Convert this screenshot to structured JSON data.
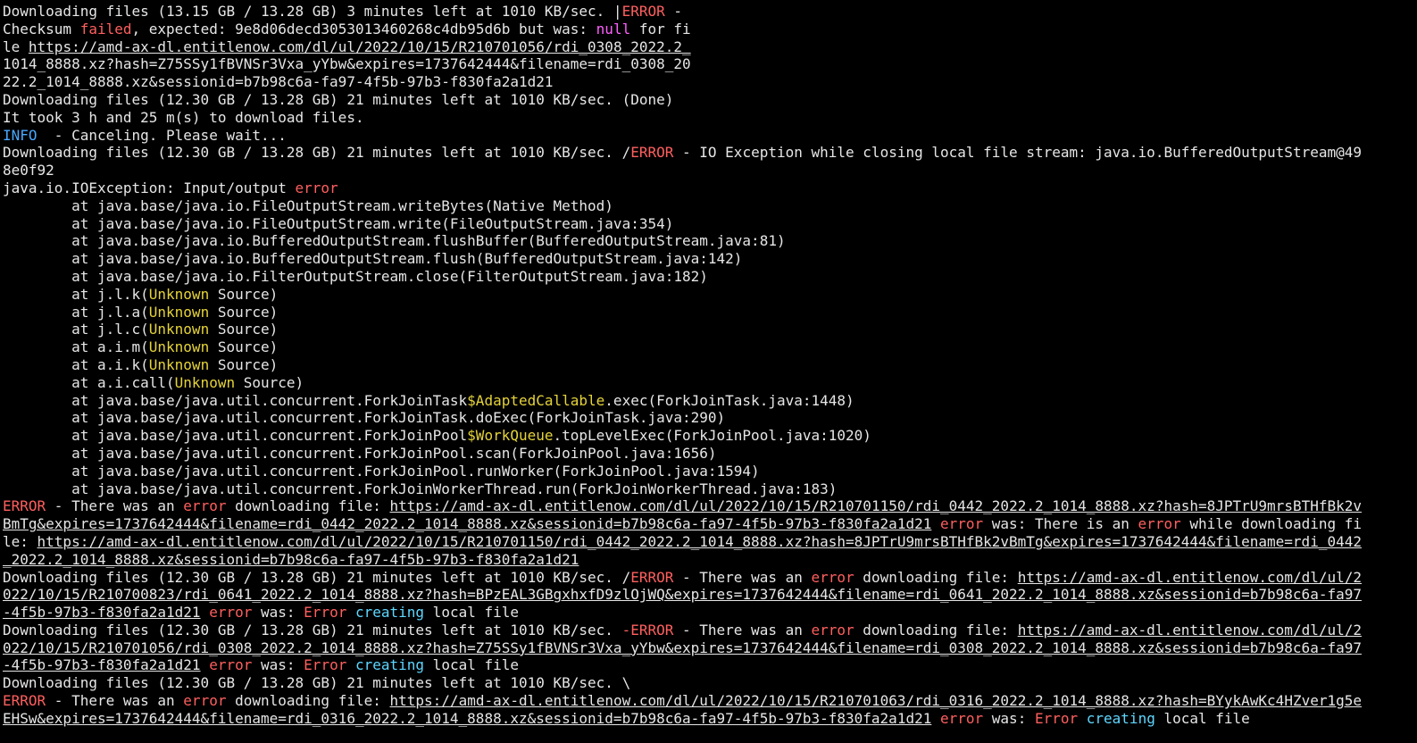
{
  "terminal": {
    "lines": [
      [
        [
          "Downloading files (13.15 GB / 13.28 GB) 3 minutes left at 1010 KB/sec. |",
          ""
        ],
        [
          "ERROR",
          "err"
        ],
        [
          " -",
          ""
        ]
      ],
      [
        [
          "Checksum ",
          ""
        ],
        [
          "failed",
          "err"
        ],
        [
          ", expected: 9e8d06decd3053013460268c4db95d6b but was: ",
          ""
        ],
        [
          "null",
          "magenta"
        ],
        [
          " for fi",
          ""
        ]
      ],
      [
        [
          "le ",
          ""
        ],
        [
          "https://amd-ax-dl.entitlenow.com/dl/ul/2022/10/15/R210701056/rdi_0308_2022.2_",
          "url"
        ]
      ],
      [
        [
          "1014_8888.xz?hash=Z75SSy1fBVNSr3Vxa_yYbw&expires=1737642444&filename=rdi_0308_20",
          ""
        ]
      ],
      [
        [
          "22.2_1014_8888.xz&sessionid=b7b98c6a-fa97-4f5b-97b3-f830fa2a1d21",
          ""
        ]
      ],
      [
        [
          "Downloading files (12.30 GB / 13.28 GB) 21 minutes left at 1010 KB/sec. (Done)",
          ""
        ]
      ],
      [
        [
          "It took 3 h and 25 m(s) to download files.",
          ""
        ]
      ],
      [
        [
          "INFO",
          "info"
        ],
        [
          "  - Canceling. Please wait...",
          ""
        ]
      ],
      [
        [
          "Downloading files (12.30 GB / 13.28 GB) 21 minutes left at 1010 KB/sec. /",
          ""
        ],
        [
          "ERROR",
          "err"
        ],
        [
          " - IO Exception while closing local file stream: java.io.BufferedOutputStream@49",
          ""
        ]
      ],
      [
        [
          "8e0f92",
          ""
        ]
      ],
      [
        [
          "java.io.IOException: Input/output ",
          ""
        ],
        [
          "error",
          "err"
        ]
      ],
      [
        [
          "        at java.base/java.io.FileOutputStream.writeBytes(Native Method)",
          ""
        ]
      ],
      [
        [
          "        at java.base/java.io.FileOutputStream.write(FileOutputStream.java:354)",
          ""
        ]
      ],
      [
        [
          "        at java.base/java.io.BufferedOutputStream.flushBuffer(BufferedOutputStream.java:81)",
          ""
        ]
      ],
      [
        [
          "        at java.base/java.io.BufferedOutputStream.flush(BufferedOutputStream.java:142)",
          ""
        ]
      ],
      [
        [
          "        at java.base/java.io.FilterOutputStream.close(FilterOutputStream.java:182)",
          ""
        ]
      ],
      [
        [
          "        at j.l.k(",
          ""
        ],
        [
          "Unknown",
          "yellow"
        ],
        [
          " Source)",
          ""
        ]
      ],
      [
        [
          "        at j.l.a(",
          ""
        ],
        [
          "Unknown",
          "yellow"
        ],
        [
          " Source)",
          ""
        ]
      ],
      [
        [
          "        at j.l.c(",
          ""
        ],
        [
          "Unknown",
          "yellow"
        ],
        [
          " Source)",
          ""
        ]
      ],
      [
        [
          "        at a.i.m(",
          ""
        ],
        [
          "Unknown",
          "yellow"
        ],
        [
          " Source)",
          ""
        ]
      ],
      [
        [
          "        at a.i.k(",
          ""
        ],
        [
          "Unknown",
          "yellow"
        ],
        [
          " Source)",
          ""
        ]
      ],
      [
        [
          "        at a.i.call(",
          ""
        ],
        [
          "Unknown",
          "yellow"
        ],
        [
          " Source)",
          ""
        ]
      ],
      [
        [
          "        at java.base/java.util.concurrent.ForkJoinTask",
          ""
        ],
        [
          "$AdaptedCallable",
          "yellow"
        ],
        [
          ".exec(ForkJoinTask.java:1448)",
          ""
        ]
      ],
      [
        [
          "        at java.base/java.util.concurrent.ForkJoinTask.doExec(ForkJoinTask.java:290)",
          ""
        ]
      ],
      [
        [
          "        at java.base/java.util.concurrent.ForkJoinPool",
          ""
        ],
        [
          "$WorkQueue",
          "yellow"
        ],
        [
          ".topLevelExec(ForkJoinPool.java:1020)",
          ""
        ]
      ],
      [
        [
          "        at java.base/java.util.concurrent.ForkJoinPool.scan(ForkJoinPool.java:1656)",
          ""
        ]
      ],
      [
        [
          "        at java.base/java.util.concurrent.ForkJoinPool.runWorker(ForkJoinPool.java:1594)",
          ""
        ]
      ],
      [
        [
          "        at java.base/java.util.concurrent.ForkJoinWorkerThread.run(ForkJoinWorkerThread.java:183)",
          ""
        ]
      ],
      [
        [
          "ERROR",
          "err"
        ],
        [
          " - There was an ",
          ""
        ],
        [
          "error",
          "err"
        ],
        [
          " downloading file: ",
          ""
        ],
        [
          "https://amd-ax-dl.entitlenow.com/dl/ul/2022/10/15/R210701150/rdi_0442_2022.2_1014_8888.xz?hash=8JPTrU9mrsBTHfBk2v",
          "url"
        ]
      ],
      [
        [
          "BmTg&expires=1737642444&filename=rdi_0442_2022.2_1014_8888.xz&sessionid=b7b98c6a-fa97-4f5b-97b3-f830fa2a1d21",
          "url"
        ],
        [
          " ",
          ""
        ],
        [
          "error",
          "err"
        ],
        [
          " was: There is an ",
          ""
        ],
        [
          "error",
          "err"
        ],
        [
          " while downloading fi",
          ""
        ]
      ],
      [
        [
          "le: ",
          ""
        ],
        [
          "https://amd-ax-dl.entitlenow.com/dl/ul/2022/10/15/R210701150/rdi_0442_2022.2_1014_8888.xz?hash=8JPTrU9mrsBTHfBk2vBmTg&expires=1737642444&filename=rdi_0442",
          "url"
        ]
      ],
      [
        [
          "_2022.2_1014_8888.xz&sessionid=b7b98c6a-fa97-4f5b-97b3-f830fa2a1d21",
          "url"
        ]
      ],
      [
        [
          "Downloading files (12.30 GB / 13.28 GB) 21 minutes left at 1010 KB/sec. /",
          ""
        ],
        [
          "ERROR",
          "err"
        ],
        [
          " - There was an ",
          ""
        ],
        [
          "error",
          "err"
        ],
        [
          " downloading file: ",
          ""
        ],
        [
          "https://amd-ax-dl.entitlenow.com/dl/ul/2",
          "url"
        ]
      ],
      [
        [
          "022/10/15/R210700823/rdi_0641_2022.2_1014_8888.xz?hash=BPzEAL3GBgxhxfD9zlOjWQ&expires=1737642444&filename=rdi_0641_2022.2_1014_8888.xz&sessionid=b7b98c6a-fa97",
          "url"
        ]
      ],
      [
        [
          "-4f5b-97b3-f830fa2a1d21",
          "url"
        ],
        [
          " ",
          ""
        ],
        [
          "error",
          "err"
        ],
        [
          " was: ",
          ""
        ],
        [
          "Error",
          "err"
        ],
        [
          " ",
          ""
        ],
        [
          "creating",
          "cyan"
        ],
        [
          " local file",
          ""
        ]
      ],
      [
        [
          "Downloading files (12.30 GB / 13.28 GB) 21 minutes left at 1010 KB/sec. ",
          ""
        ],
        [
          "-ERROR",
          "err"
        ],
        [
          " - There was an ",
          ""
        ],
        [
          "error",
          "err"
        ],
        [
          " downloading file: ",
          ""
        ],
        [
          "https://amd-ax-dl.entitlenow.com/dl/ul/2",
          "url"
        ]
      ],
      [
        [
          "022/10/15/R210701056/rdi_0308_2022.2_1014_8888.xz?hash=Z75SSy1fBVNSr3Vxa_yYbw&expires=1737642444&filename=rdi_0308_2022.2_1014_8888.xz&sessionid=b7b98c6a-fa97",
          "url"
        ]
      ],
      [
        [
          "-4f5b-97b3-f830fa2a1d21",
          "url"
        ],
        [
          " ",
          ""
        ],
        [
          "error",
          "err"
        ],
        [
          " was: ",
          ""
        ],
        [
          "Error",
          "err"
        ],
        [
          " ",
          ""
        ],
        [
          "creating",
          "cyan"
        ],
        [
          " local file",
          ""
        ]
      ],
      [
        [
          "Downloading files (12.30 GB / 13.28 GB) 21 minutes left at 1010 KB/sec. \\",
          ""
        ]
      ],
      [
        [
          "ERROR",
          "err"
        ],
        [
          " - There was an ",
          ""
        ],
        [
          "error",
          "err"
        ],
        [
          " downloading file: ",
          ""
        ],
        [
          "https://amd-ax-dl.entitlenow.com/dl/ul/2022/10/15/R210701063/rdi_0316_2022.2_1014_8888.xz?hash=BYykAwKc4HZver1g5e",
          "url"
        ]
      ],
      [
        [
          "EHSw&expires=1737642444&filename=rdi_0316_2022.2_1014_8888.xz&sessionid=b7b98c6a-fa97-4f5b-97b3-f830fa2a1d21",
          "url"
        ],
        [
          " ",
          ""
        ],
        [
          "error",
          "err"
        ],
        [
          " was: ",
          ""
        ],
        [
          "Error",
          "err"
        ],
        [
          " ",
          ""
        ],
        [
          "creating",
          "cyan"
        ],
        [
          " local file",
          ""
        ]
      ]
    ]
  }
}
